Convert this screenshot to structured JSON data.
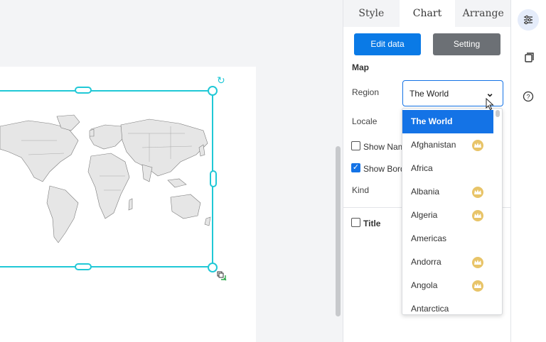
{
  "panel": {
    "tabs": [
      {
        "label": "Style",
        "active": false
      },
      {
        "label": "Chart",
        "active": true
      },
      {
        "label": "Arrange",
        "active": false
      }
    ],
    "edit_data_label": "Edit data",
    "setting_label": "Setting",
    "section_title": "Map",
    "region_label": "Region",
    "region_value": "The World",
    "locale_label": "Locale",
    "show_names_label": "Show Nam",
    "show_names_checked": false,
    "show_border_label": "Show Bord",
    "show_border_checked": true,
    "kind_label": "Kind",
    "title_label": "Title",
    "title_checked": false
  },
  "dropdown": {
    "items": [
      {
        "label": "The World",
        "selected": true,
        "premium": false
      },
      {
        "label": "Afghanistan",
        "selected": false,
        "premium": true
      },
      {
        "label": "Africa",
        "selected": false,
        "premium": false
      },
      {
        "label": "Albania",
        "selected": false,
        "premium": true
      },
      {
        "label": "Algeria",
        "selected": false,
        "premium": true
      },
      {
        "label": "Americas",
        "selected": false,
        "premium": false
      },
      {
        "label": "Andorra",
        "selected": false,
        "premium": true
      },
      {
        "label": "Angola",
        "selected": false,
        "premium": true
      },
      {
        "label": "Antarctica",
        "selected": false,
        "premium": false
      }
    ]
  },
  "rail": {
    "icons": [
      "sliders-icon",
      "copy-icon",
      "help-icon"
    ]
  },
  "colors": {
    "accent": "#1473e6",
    "selection": "#20c8d6",
    "crown": "#e8c468"
  }
}
